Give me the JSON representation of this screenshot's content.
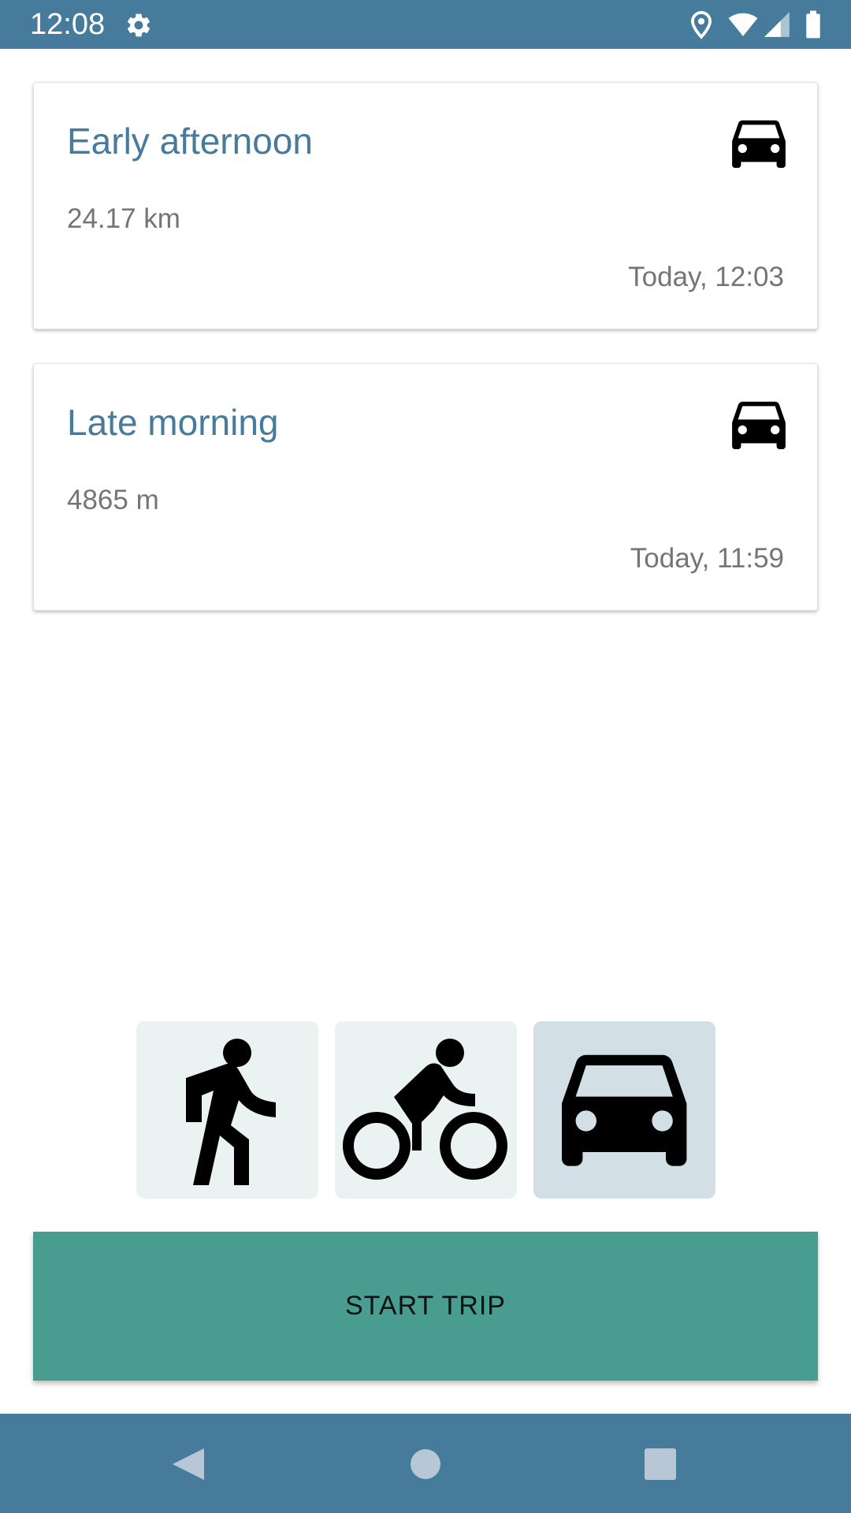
{
  "status_bar": {
    "time": "12:08",
    "icons": [
      "gear-icon",
      "location-icon",
      "wifi-icon",
      "signal-icon",
      "battery-icon"
    ]
  },
  "trips": [
    {
      "title": "Early afternoon",
      "distance": "24.17 km",
      "time": "Today, 12:03",
      "mode_icon": "car-icon"
    },
    {
      "title": "Late morning",
      "distance": "4865 m",
      "time": "Today, 11:59",
      "mode_icon": "car-icon"
    }
  ],
  "mode_selector": {
    "options": [
      "walk-icon",
      "bike-icon",
      "car-icon"
    ],
    "selected": "car-icon"
  },
  "start_button": {
    "label": "START TRIP"
  },
  "nav_bar": {
    "icons": [
      "back-icon",
      "home-icon",
      "recents-icon"
    ]
  },
  "colors": {
    "primary": "#477b9b",
    "accent_button": "#489d90",
    "mode_bg": "#eaf2f2",
    "mode_selected_bg": "#d2dfe6",
    "secondary_text": "#757575"
  }
}
